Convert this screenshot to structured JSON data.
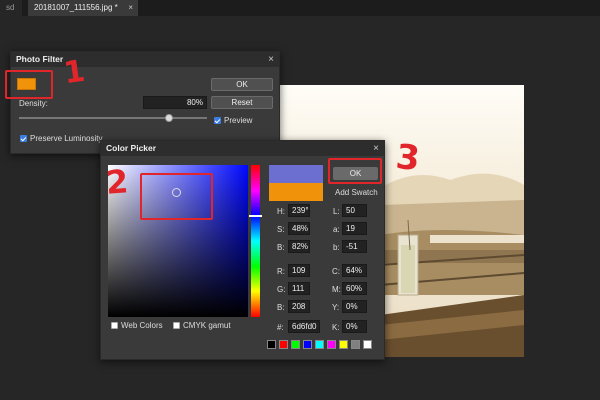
{
  "tabs": [
    {
      "label": "sd"
    },
    {
      "label": "20181007_111556.jpg *",
      "close": "×"
    }
  ],
  "photo_filter": {
    "title": "Photo Filter",
    "close": "×",
    "swatch_color": "#f0920a",
    "density_label": "Density:",
    "density_value": "80%",
    "density": 0.8,
    "ok_label": "OK",
    "reset_label": "Reset",
    "preview_label": "Preview",
    "preview_checked": true,
    "preserve_label": "Preserve Luminosity",
    "preserve_checked": true
  },
  "color_picker": {
    "title": "Color Picker",
    "close": "×",
    "ok_label": "OK",
    "add_swatch_label": "Add Swatch",
    "new_color": "#6d6fd0",
    "old_color": "#f0920a",
    "web_colors_label": "Web Colors",
    "cmyk_gamut_label": "CMYK gamut",
    "fields": {
      "H": {
        "label": "H:",
        "value": "239°"
      },
      "S": {
        "label": "S:",
        "value": "48%"
      },
      "Bv": {
        "label": "B:",
        "value": "82%"
      },
      "R": {
        "label": "R:",
        "value": "109"
      },
      "G": {
        "label": "G:",
        "value": "111"
      },
      "B": {
        "label": "B:",
        "value": "208"
      },
      "hex": {
        "label": "#:",
        "value": "6d6fd0"
      },
      "L": {
        "label": "L:",
        "value": "50"
      },
      "a": {
        "label": "a:",
        "value": "19"
      },
      "b": {
        "label": "b:",
        "value": "-51"
      },
      "C": {
        "label": "C:",
        "value": "64%"
      },
      "M": {
        "label": "M:",
        "value": "60%"
      },
      "Y": {
        "label": "Y:",
        "value": "0%"
      },
      "K": {
        "label": "K:",
        "value": "0%"
      }
    },
    "swatches": [
      "#000000",
      "#ff0000",
      "#00ff00",
      "#0000ff",
      "#00ffff",
      "#ff00ff",
      "#ffff00",
      "#808080",
      "#ffffff"
    ]
  },
  "annotations": {
    "one": "1",
    "two": "2",
    "three": "3"
  }
}
